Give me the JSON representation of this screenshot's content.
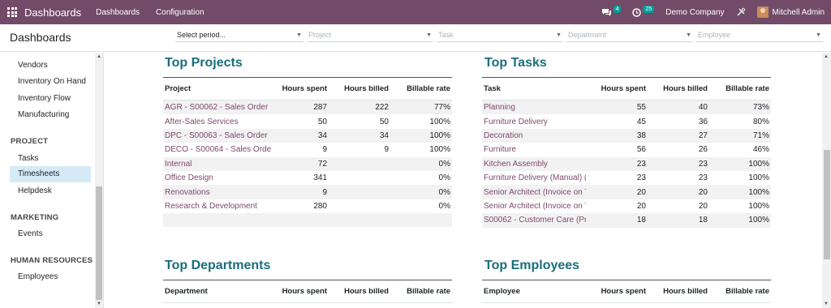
{
  "navbar": {
    "brand": "Dashboards",
    "menu": [
      "Dashboards",
      "Configuration"
    ],
    "messages_count": "4",
    "activities_count": "25",
    "company": "Demo Company",
    "user": "Mitchell Admin",
    "color": "#714B67"
  },
  "control": {
    "title": "Dashboards",
    "filters": [
      {
        "label": "Select period...",
        "active": true
      },
      {
        "label": "Project",
        "active": false
      },
      {
        "label": "Task",
        "active": false
      },
      {
        "label": "Department",
        "active": false
      },
      {
        "label": "Employee",
        "active": false
      }
    ]
  },
  "sidebar": {
    "items": [
      {
        "label": "Vendors"
      },
      {
        "label": "Inventory On Hand"
      },
      {
        "label": "Inventory Flow"
      },
      {
        "label": "Manufacturing"
      }
    ],
    "project_heading": "PROJECT",
    "project_items": [
      {
        "label": "Tasks"
      },
      {
        "label": "Timesheets"
      },
      {
        "label": "Helpdesk"
      }
    ],
    "marketing_heading": "MARKETING",
    "marketing_items": [
      {
        "label": "Events"
      }
    ],
    "hr_heading": "HUMAN RESOURCES",
    "hr_items": [
      {
        "label": "Employees"
      }
    ]
  },
  "top_projects": {
    "title": "Top Projects",
    "headers": [
      "Project",
      "Hours spent",
      "Hours billed",
      "Billable rate"
    ],
    "rows": [
      [
        "AGR - S00062 - Sales Order",
        "287",
        "222",
        "77%"
      ],
      [
        "After-Sales Services",
        "50",
        "50",
        "100%"
      ],
      [
        "DPC - S00063 - Sales Order",
        "34",
        "34",
        "100%"
      ],
      [
        "DECO - S00064 - Sales Orde",
        "9",
        "9",
        "100%"
      ],
      [
        "Internal",
        "72",
        "",
        "0%"
      ],
      [
        "Office Design",
        "341",
        "",
        "0%"
      ],
      [
        "Renovations",
        "9",
        "",
        "0%"
      ],
      [
        "Research & Development",
        "280",
        "",
        "0%"
      ]
    ]
  },
  "top_tasks": {
    "title": "Top Tasks",
    "headers": [
      "Task",
      "Hours spent",
      "Hours billed",
      "Billable rate"
    ],
    "rows": [
      [
        "Planning",
        "55",
        "40",
        "73%"
      ],
      [
        "Furniture Delivery",
        "45",
        "36",
        "80%"
      ],
      [
        "Decoration",
        "38",
        "27",
        "71%"
      ],
      [
        "Furniture",
        "56",
        "26",
        "46%"
      ],
      [
        "Kitchen Assembly",
        "23",
        "23",
        "100%"
      ],
      [
        "Furniture Delivery (Manual)  (S",
        "23",
        "23",
        "100%"
      ],
      [
        "Senior Architect (Invoice on Ti",
        "20",
        "20",
        "100%"
      ],
      [
        "Senior Architect (Invoice on Ti",
        "20",
        "20",
        "100%"
      ],
      [
        "S00062 - Customer Care (Pre",
        "18",
        "18",
        "100%"
      ]
    ]
  },
  "top_departments": {
    "title": "Top Departments",
    "headers": [
      "Department",
      "Hours spent",
      "Hours billed",
      "Billable rate"
    ]
  },
  "top_employees": {
    "title": "Top Employees",
    "headers": [
      "Employee",
      "Hours spent",
      "Hours billed",
      "Billable rate"
    ]
  }
}
